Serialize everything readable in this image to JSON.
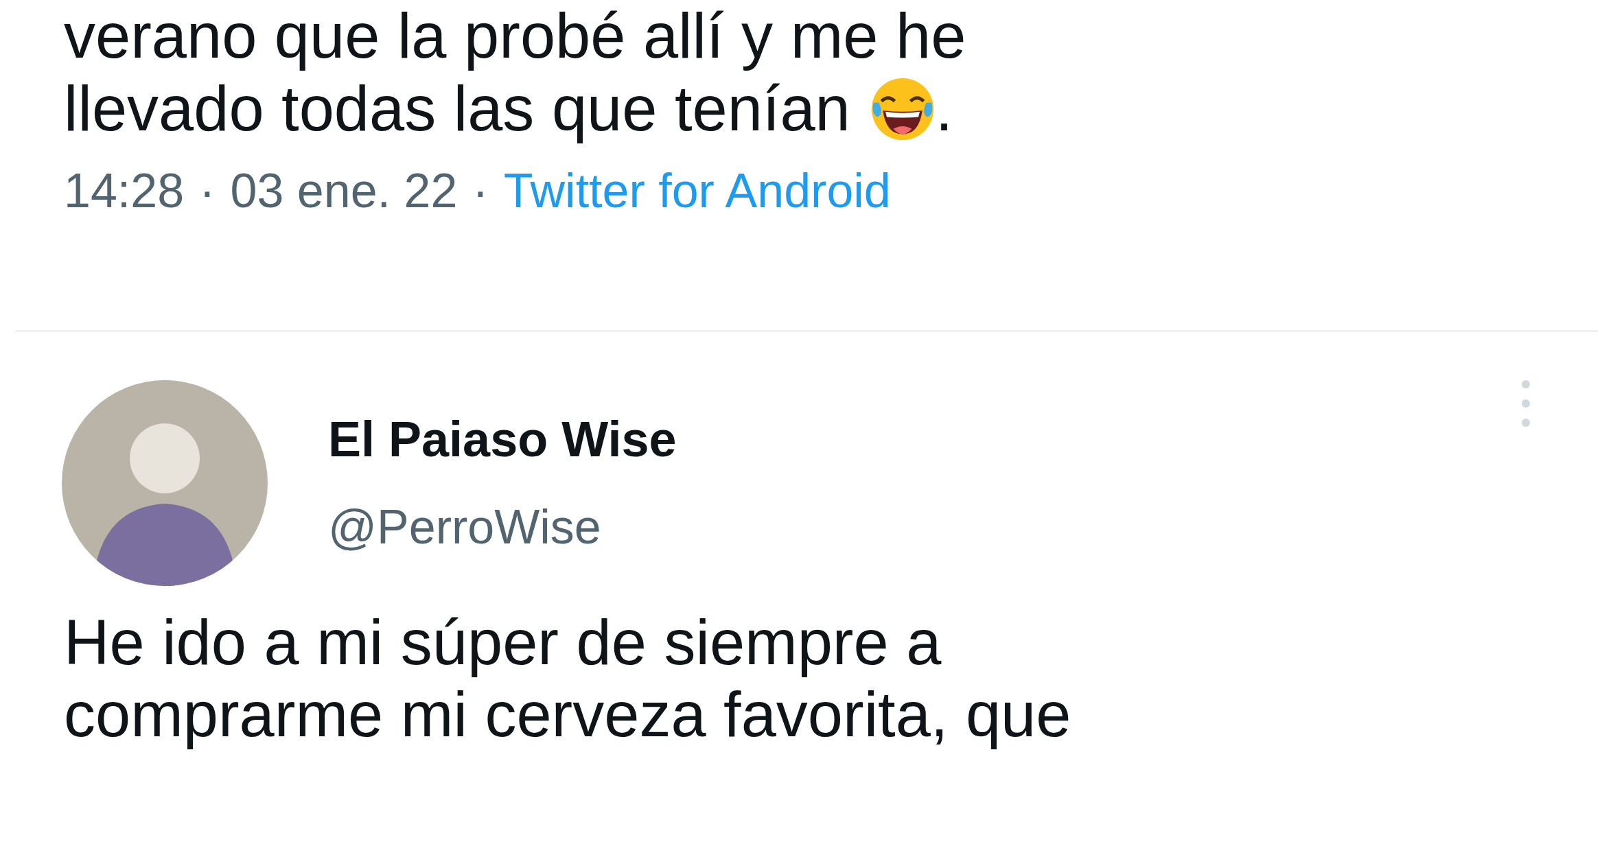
{
  "previous_tweet": {
    "text_lines": [
      "verano que la probé allí y me he",
      "llevado todas las que tenían"
    ],
    "trailing": ".",
    "time": "14:28",
    "sep1": "·",
    "date": "03 ene. 22",
    "sep2": "·",
    "source": "Twitter for Android"
  },
  "tweet": {
    "name": "El Paiaso Wise",
    "handle": "@PerroWise",
    "text_lines": [
      "He ido a mi súper de siempre a",
      "comprarme mi cerveza favorita, que"
    ]
  }
}
